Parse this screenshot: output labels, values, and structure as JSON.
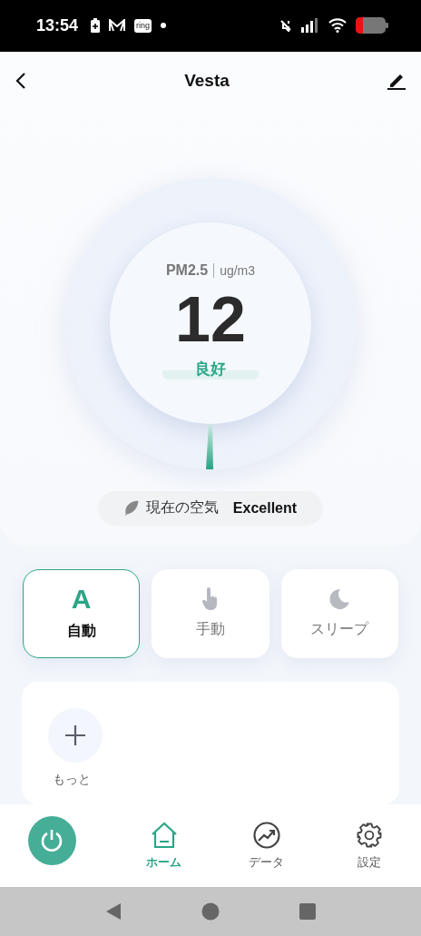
{
  "status_bar": {
    "time": "13:54",
    "notification_badge": "ring"
  },
  "header": {
    "title": "Vesta"
  },
  "gauge": {
    "metric": "PM2.5",
    "unit": "ug/m3",
    "value": "12",
    "rating": "良好"
  },
  "air_quality": {
    "label": "現在の空気",
    "value": "Excellent"
  },
  "modes": [
    {
      "kind": "auto",
      "icon_text": "A",
      "label": "自動",
      "selected": true
    },
    {
      "kind": "manual",
      "label": "手動",
      "selected": false
    },
    {
      "kind": "sleep",
      "label": "スリープ",
      "selected": false
    }
  ],
  "more": {
    "label": "もっと"
  },
  "bottom_nav": [
    {
      "kind": "home",
      "label": "ホーム",
      "selected": true
    },
    {
      "kind": "data",
      "label": "データ",
      "selected": false
    },
    {
      "kind": "settings",
      "label": "設定",
      "selected": false
    }
  ]
}
